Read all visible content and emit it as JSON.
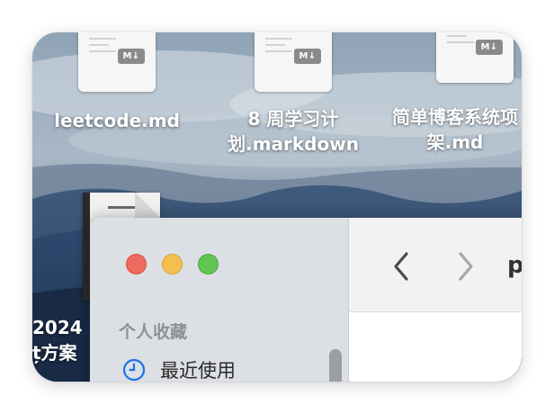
{
  "desktop": {
    "files": [
      {
        "badge": "M↓",
        "name_lines": [
          "leetcode.md"
        ]
      },
      {
        "badge": "M↓",
        "name_lines": [
          "8 周学习计",
          "划.markdown"
        ]
      },
      {
        "badge": "M↓",
        "name_lines": [
          "简单博客系统项",
          "架.md"
        ]
      }
    ],
    "partial_file": {
      "name_lines": [
        "2024",
        "ț方案"
      ]
    }
  },
  "finder": {
    "sidebar": {
      "section_title": "个人收藏",
      "items": [
        {
          "label": "最近使用",
          "icon": "clock-icon"
        }
      ]
    },
    "toolbar": {
      "back_icon": "chevron-left-icon",
      "forward_icon": "chevron-right-icon",
      "path_text": "p"
    },
    "window_buttons": {
      "close": "#ed6a5e",
      "minimize": "#f4bf4f",
      "zoom": "#61c554"
    }
  },
  "colors": {
    "accent": "#1a73e8",
    "sidebar_bg": "#dcdfe3",
    "toolbar_bg": "#f2f2f2"
  }
}
